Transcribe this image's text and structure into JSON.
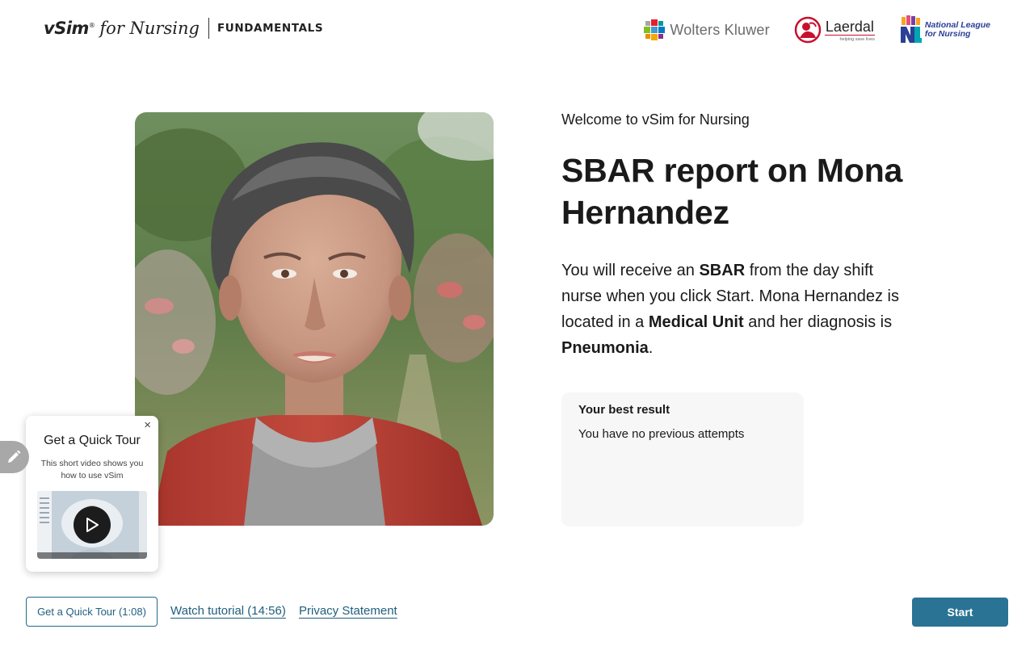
{
  "header": {
    "brand": {
      "vsim": "vSim",
      "trademark": "®",
      "for": "for Nursing",
      "edition": "FUNDAMENTALS"
    },
    "partners": {
      "wolters_kluwer": "Wolters Kluwer",
      "laerdal": "Laerdal",
      "laerdal_tagline": "helping save lives",
      "nln_line1": "National League",
      "nln_line2": "for Nursing"
    }
  },
  "main": {
    "welcome": "Welcome to vSim for Nursing",
    "title": "SBAR report on Mona Hernandez",
    "description": {
      "p1": "You will receive an ",
      "b1": "SBAR",
      "p2": " from the day shift nurse when you click Start. Mona Hernandez is located in a ",
      "b2": "Medical Unit",
      "p3": " and her diagnosis is ",
      "b3": "Pneumonia",
      "p4": "."
    },
    "best_result": {
      "title": "Your best result",
      "text": "You have no previous attempts"
    }
  },
  "tour_popover": {
    "close": "×",
    "title": "Get a Quick Tour",
    "description": "This short video shows you how to use vSim"
  },
  "footer": {
    "quick_tour_button": "Get a Quick Tour (1:08)",
    "watch_tutorial": "Watch tutorial (14:56)",
    "privacy": "Privacy Statement",
    "start": "Start"
  },
  "colors": {
    "accent": "#2a7394",
    "link": "#1f5e7d",
    "card_bg": "#f7f7f7"
  },
  "icons": {
    "play": "play-icon",
    "close": "close-icon",
    "edit": "pencil-icon"
  }
}
